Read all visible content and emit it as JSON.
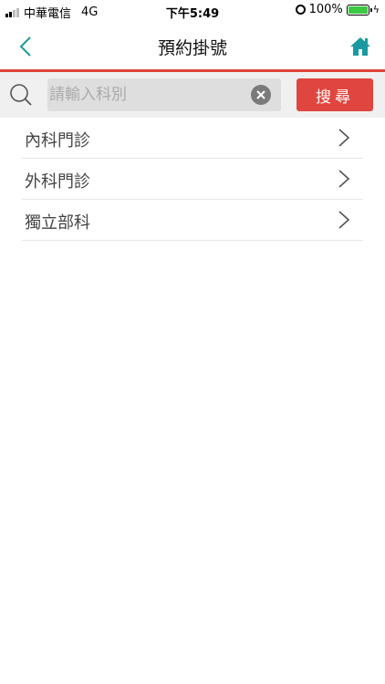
{
  "status_bar": {
    "carrier": "中華電信",
    "network": "4G",
    "time": "下午5:49",
    "battery_percent": "100%",
    "battery_level": 1.0,
    "battery_color": "#3cc843"
  },
  "nav": {
    "title": "預約掛號",
    "back_icon": "chevron-left-icon",
    "home_icon": "home-icon",
    "accent_color": "#1a9aa0"
  },
  "search": {
    "placeholder": "請輸入科別",
    "value": "",
    "button_label": "搜尋",
    "button_color": "#e0453f"
  },
  "departments": [
    {
      "label": "內科門診"
    },
    {
      "label": "外科門診"
    },
    {
      "label": "獨立部科"
    }
  ]
}
